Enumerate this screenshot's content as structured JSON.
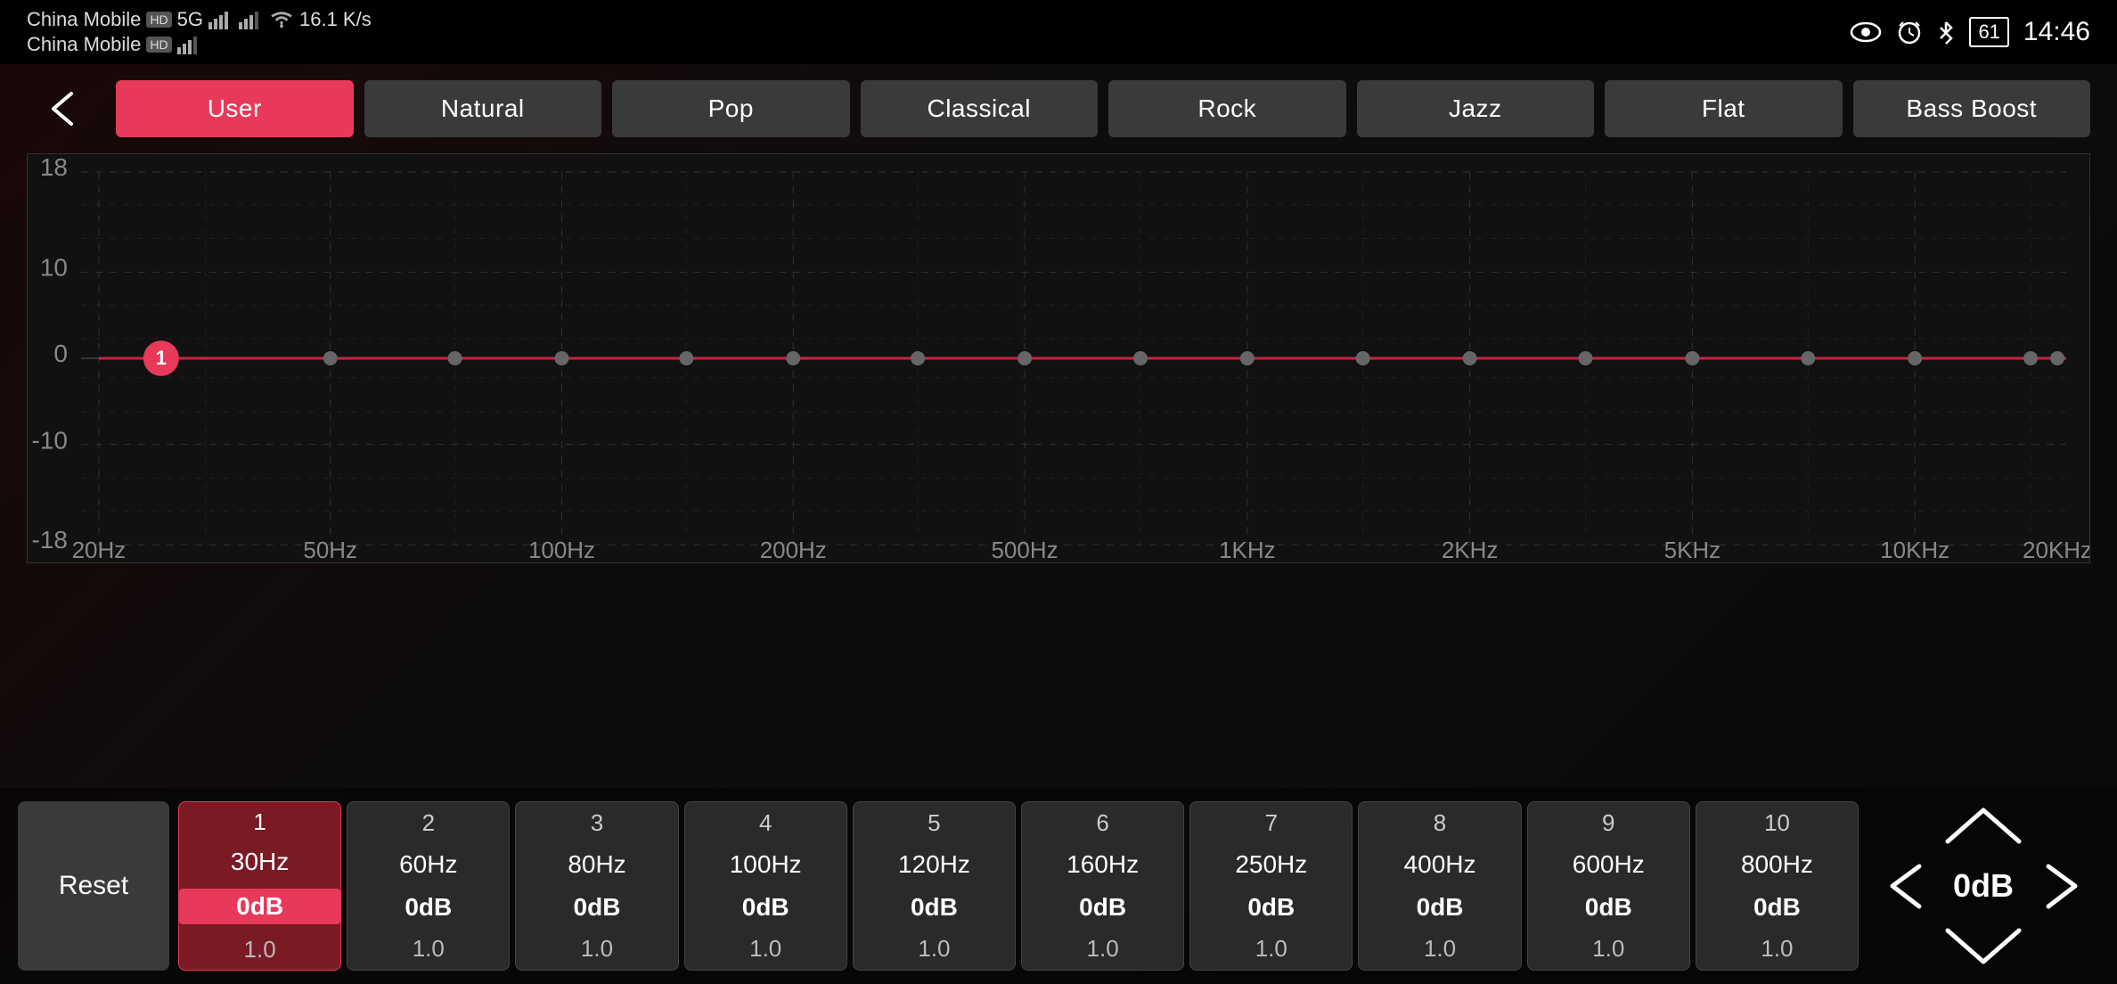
{
  "statusBar": {
    "carrier1": "China Mobile",
    "carrier1_hd": "HD",
    "carrier1_gen": "5G",
    "carrier2": "China Mobile",
    "carrier2_hd": "HD",
    "network_speed": "16.1 K/s",
    "time": "14:46",
    "battery": "61"
  },
  "header": {
    "back_label": "←"
  },
  "presets": [
    {
      "id": "user",
      "label": "User",
      "active": true
    },
    {
      "id": "natural",
      "label": "Natural",
      "active": false
    },
    {
      "id": "pop",
      "label": "Pop",
      "active": false
    },
    {
      "id": "classical",
      "label": "Classical",
      "active": false
    },
    {
      "id": "rock",
      "label": "Rock",
      "active": false
    },
    {
      "id": "jazz",
      "label": "Jazz",
      "active": false
    },
    {
      "id": "flat",
      "label": "Flat",
      "active": false
    },
    {
      "id": "bass-boost",
      "label": "Bass Boost",
      "active": false
    }
  ],
  "chart": {
    "yLabels": [
      "18",
      "10",
      "0",
      "-10",
      "-18"
    ],
    "xLabels": [
      "20Hz",
      "50Hz",
      "100Hz",
      "200Hz",
      "500Hz",
      "1KHz",
      "2KHz",
      "5KHz",
      "10KHz",
      "20KHz"
    ]
  },
  "bands": [
    {
      "num": "1",
      "freq": "30Hz",
      "db": "0dB",
      "q": "1.0",
      "active": true
    },
    {
      "num": "2",
      "freq": "60Hz",
      "db": "0dB",
      "q": "1.0",
      "active": false
    },
    {
      "num": "3",
      "freq": "80Hz",
      "db": "0dB",
      "q": "1.0",
      "active": false
    },
    {
      "num": "4",
      "freq": "100Hz",
      "db": "0dB",
      "q": "1.0",
      "active": false
    },
    {
      "num": "5",
      "freq": "120Hz",
      "db": "0dB",
      "q": "1.0",
      "active": false
    },
    {
      "num": "6",
      "freq": "160Hz",
      "db": "0dB",
      "q": "1.0",
      "active": false
    },
    {
      "num": "7",
      "freq": "250Hz",
      "db": "0dB",
      "q": "1.0",
      "active": false
    },
    {
      "num": "8",
      "freq": "400Hz",
      "db": "0dB",
      "q": "1.0",
      "active": false
    },
    {
      "num": "9",
      "freq": "600Hz",
      "db": "0dB",
      "q": "1.0",
      "active": false
    },
    {
      "num": "10",
      "freq": "800Hz",
      "db": "0dB",
      "q": "1.0",
      "active": false
    }
  ],
  "controls": {
    "reset_label": "Reset",
    "current_value": "0dB"
  }
}
